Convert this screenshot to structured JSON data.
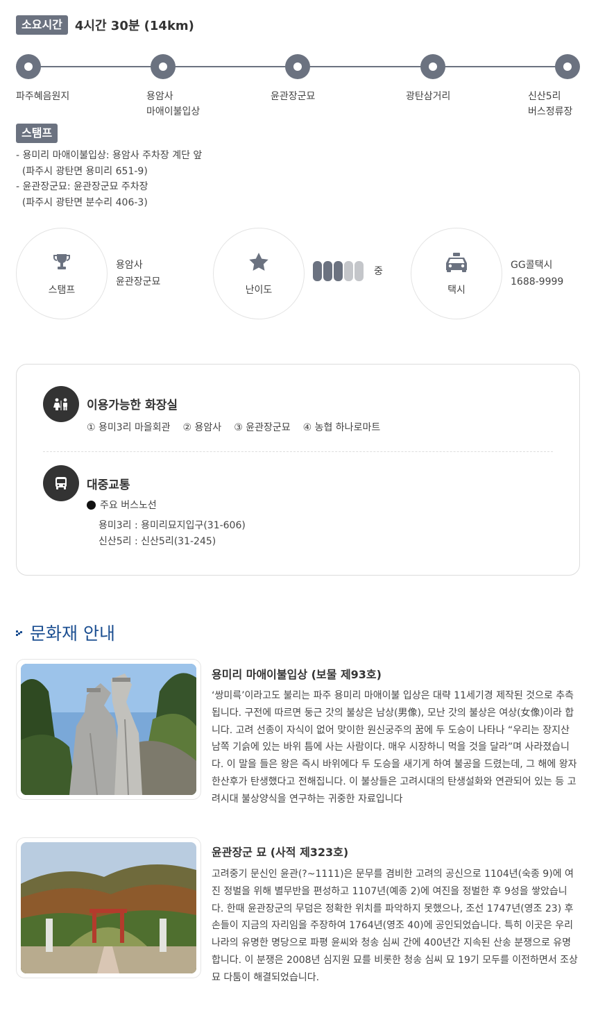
{
  "duration": {
    "label": "소요시간",
    "value": "4시간 30분 (14km)"
  },
  "route": {
    "stops": [
      {
        "label": "파주혜음원지"
      },
      {
        "label": "용암사\n마애이불입상"
      },
      {
        "label": "윤관장군묘"
      },
      {
        "label": "광탄삼거리"
      },
      {
        "label": "신산5리\n버스정류장"
      }
    ]
  },
  "stamp": {
    "label": "스탬프",
    "lines": [
      "- 용미리 마애이불입상: 용암사 주차장 계단 앞",
      "  (파주시 광탄면 용미리 651-9)",
      "- 윤관장군묘: 윤관장군묘 주차장",
      "  (파주시 광탄면 분수리 406-3)"
    ]
  },
  "info": {
    "stamp": {
      "icon": "trophy-icon",
      "label": "스탬프",
      "line1": "용암사",
      "line2": "윤관장군묘"
    },
    "difficulty": {
      "icon": "star-icon",
      "label": "난이도",
      "level": 3,
      "max": 5,
      "value": "중"
    },
    "taxi": {
      "icon": "taxi-icon",
      "label": "택시",
      "line1": "GG콜택시",
      "line2": "1688-9999"
    }
  },
  "facilities": {
    "toilets": {
      "icon": "restroom-icon",
      "title": "이용가능한 화장실",
      "items": [
        "① 용미3리 마을회관",
        "② 용암사",
        "③ 윤관장군묘",
        "④ 농협 하나로마트"
      ]
    },
    "transit": {
      "icon": "bus-icon",
      "title": "대중교통",
      "subtitle": "주요 버스노선",
      "routes": [
        "용미3리 : 용미리묘지입구(31-606)",
        "신산5리 : 신산5리(31-245)"
      ]
    }
  },
  "heritage": {
    "title": "문화재 안내",
    "items": [
      {
        "title": "용미리 마애이불입상 (보물 제93호)",
        "desc": "‘쌍미륵’이라고도 불리는 파주 용미리 마애이불 입상은 대략 11세기경 제작된 것으로 추측됩니다. 구전에 따르면 둥근 갓의 불상은 남상(男像), 모난 갓의 불상은 여상(女像)이라 합니다. 고려 선종이 자식이 없어 맞이한 원신궁주의 꿈에 두 도승이 나타나 “우리는 장지산 남쪽 기슭에 있는 바위 틈에 사는 사람이다. 매우 시장하니 먹을 것을 달라”며 사라졌습니다. 이 말을 들은 왕은 즉시 바위에다 두 도승을 새기게 하여 불공을 드렸는데, 그 해에 왕자 한산후가 탄생했다고 전해집니다. 이 불상들은 고려시대의 탄생설화와 연관되어 있는 등 고려시대 불상양식을 연구하는 귀중한 자료입니다"
      },
      {
        "title": "윤관장군 묘 (사적 제323호)",
        "desc": "고려중기 문신인 윤관(?~1111)은 문무를 겸비한 고려의 공신으로 1104년(숙종 9)에 여진 정벌을 위해 별무반을 편성하고 1107년(예종 2)에 여진을 정벌한 후 9성을 쌓았습니다. 한때 윤관장군의 무덤은 정확한 위치를 파악하지 못했으나, 조선 1747년(영조 23) 후손들이 지금의 자리임을 주장하여 1764년(영조 40)에 공인되었습니다. 특히 이곳은 우리나라의 유명한 명당으로 파평 윤씨와 청송 심씨 간에 400년간 지속된 산송 분쟁으로 유명합니다. 이 분쟁은 2008년 심지원 묘를 비롯한 청송 심씨 묘 19기 모두를 이전하면서 조상묘 다툼이 해결되었습니다."
      }
    ]
  },
  "colors": {
    "badge": "#6b7280",
    "heading_blue": "#1c4f91",
    "bar_on": "#6b7280",
    "bar_off": "#c4c6ca"
  }
}
